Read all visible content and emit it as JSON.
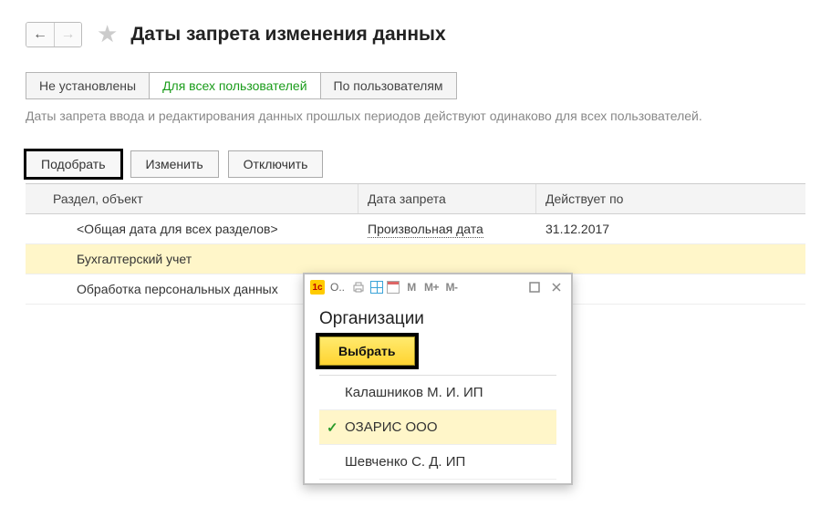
{
  "header": {
    "title": "Даты запрета изменения данных"
  },
  "tabs": {
    "not_set": "Не установлены",
    "all_users": "Для всех пользователей",
    "by_users": "По пользователям"
  },
  "description": "Даты запрета ввода и редактирования данных прошлых периодов действуют одинаково для всех пользователей.",
  "toolbar": {
    "pick": "Подобрать",
    "edit": "Изменить",
    "disable": "Отключить"
  },
  "table": {
    "cols": {
      "section": "Раздел, объект",
      "ban_date": "Дата запрета",
      "effective": "Действует по"
    },
    "rows": [
      {
        "section": "<Общая дата для всех разделов>",
        "ban_date": "Произвольная дата",
        "effective": "31.12.2017",
        "link": true
      },
      {
        "section": "Бухгалтерский учет",
        "ban_date": "",
        "effective": "",
        "selected": true
      },
      {
        "section": "Обработка персональных данных",
        "ban_date": "",
        "effective": ""
      }
    ]
  },
  "popup": {
    "app_icon_text": "1c",
    "short_title": "О..",
    "heading": "Организации",
    "select_label": "Выбрать",
    "toolbar_m": "M",
    "toolbar_mplus": "M+",
    "toolbar_mminus": "M-",
    "items": [
      {
        "label": "Калашников М. И. ИП",
        "selected": false
      },
      {
        "label": "ОЗАРИС ООО",
        "selected": true
      },
      {
        "label": "Шевченко С. Д. ИП",
        "selected": false
      }
    ]
  }
}
